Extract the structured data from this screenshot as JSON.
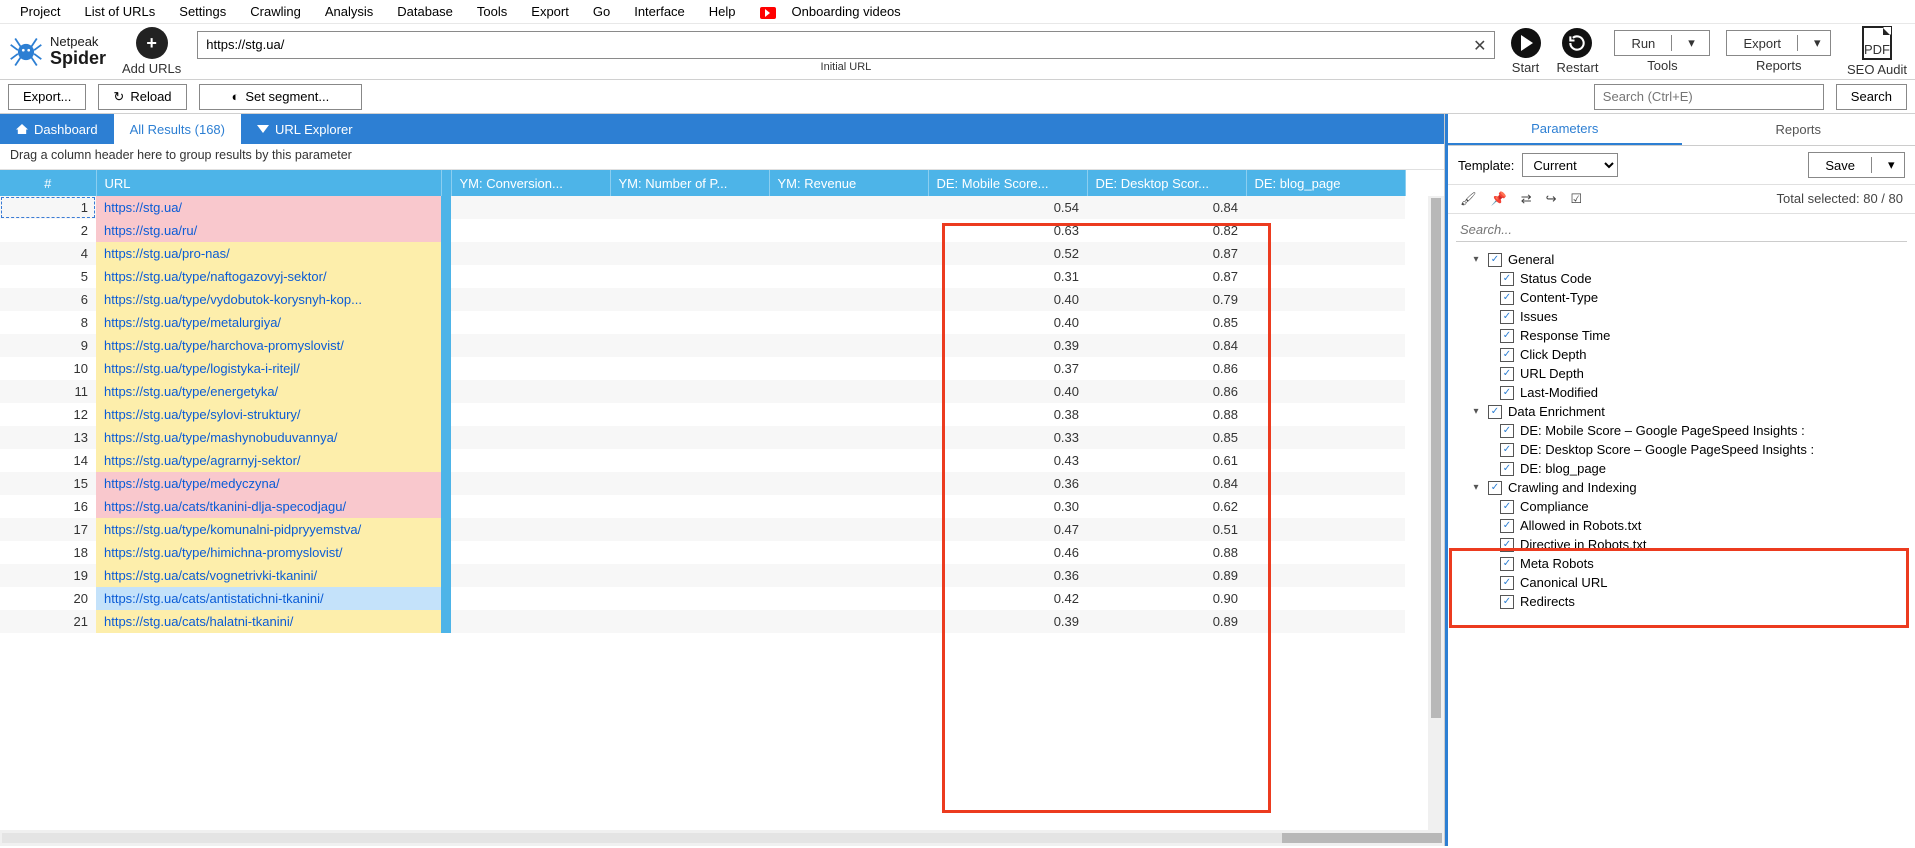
{
  "menu": [
    "Project",
    "List of URLs",
    "Settings",
    "Crawling",
    "Analysis",
    "Database",
    "Tools",
    "Export",
    "Go",
    "Interface",
    "Help"
  ],
  "menu_onboarding": "Onboarding videos",
  "logo": {
    "l1": "Netpeak",
    "l2": "Spider"
  },
  "toolbar": {
    "add_urls": "Add URLs",
    "initial_url": "Initial URL",
    "url_value": "https://stg.ua/",
    "start": "Start",
    "restart": "Restart",
    "run": "Run",
    "tools": "Tools",
    "export": "Export",
    "reports": "Reports",
    "seo_audit": "SEO Audit",
    "pdf": "PDF"
  },
  "toolbar2": {
    "export": "Export...",
    "reload": "Reload",
    "set_segment": "Set segment...",
    "search_ph": "Search (Ctrl+E)",
    "search": "Search"
  },
  "tabs": {
    "dashboard": "Dashboard",
    "all_results": "All Results (168)",
    "url_explorer": "URL Explorer"
  },
  "group_hint": "Drag a column header here to group results by this parameter",
  "columns": {
    "idx": "#",
    "url": "URL",
    "ym1": "YM: Conversion...",
    "ym2": "YM: Number of P...",
    "ym3": "YM: Revenue",
    "de1": "DE: Mobile Score...",
    "de2": "DE: Desktop Scor...",
    "de3": "DE: blog_page"
  },
  "rows": [
    {
      "i": 1,
      "url": "https://stg.ua/",
      "m": "0.54",
      "d": "0.84",
      "c": "pink",
      "sel": true
    },
    {
      "i": 2,
      "url": "https://stg.ua/ru/",
      "m": "0.63",
      "d": "0.82",
      "c": "pink"
    },
    {
      "i": 4,
      "url": "https://stg.ua/pro-nas/",
      "m": "0.52",
      "d": "0.87",
      "c": "yellow"
    },
    {
      "i": 5,
      "url": "https://stg.ua/type/naftogazovyj-sektor/",
      "m": "0.31",
      "d": "0.87",
      "c": "yellow"
    },
    {
      "i": 6,
      "url": "https://stg.ua/type/vydobutok-korysnyh-kop...",
      "m": "0.40",
      "d": "0.79",
      "c": "yellow"
    },
    {
      "i": 8,
      "url": "https://stg.ua/type/metalurgiya/",
      "m": "0.40",
      "d": "0.85",
      "c": "yellow"
    },
    {
      "i": 9,
      "url": "https://stg.ua/type/harchova-promyslovist/",
      "m": "0.39",
      "d": "0.84",
      "c": "yellow"
    },
    {
      "i": 10,
      "url": "https://stg.ua/type/logistyka-i-ritejl/",
      "m": "0.37",
      "d": "0.86",
      "c": "yellow"
    },
    {
      "i": 11,
      "url": "https://stg.ua/type/energetyka/",
      "m": "0.40",
      "d": "0.86",
      "c": "yellow"
    },
    {
      "i": 12,
      "url": "https://stg.ua/type/sylovi-struktury/",
      "m": "0.38",
      "d": "0.88",
      "c": "yellow"
    },
    {
      "i": 13,
      "url": "https://stg.ua/type/mashynobuduvannya/",
      "m": "0.33",
      "d": "0.85",
      "c": "yellow"
    },
    {
      "i": 14,
      "url": "https://stg.ua/type/agrarnyj-sektor/",
      "m": "0.43",
      "d": "0.61",
      "c": "yellow"
    },
    {
      "i": 15,
      "url": "https://stg.ua/type/medyczyna/",
      "m": "0.36",
      "d": "0.84",
      "c": "pink"
    },
    {
      "i": 16,
      "url": "https://stg.ua/cats/tkanini-dlja-specodjagu/",
      "m": "0.30",
      "d": "0.62",
      "c": "pink"
    },
    {
      "i": 17,
      "url": "https://stg.ua/type/komunalni-pidpryyemstva/",
      "m": "0.47",
      "d": "0.51",
      "c": "yellow"
    },
    {
      "i": 18,
      "url": "https://stg.ua/type/himichna-promyslovist/",
      "m": "0.46",
      "d": "0.88",
      "c": "yellow"
    },
    {
      "i": 19,
      "url": "https://stg.ua/cats/vognetrivki-tkanini/",
      "m": "0.36",
      "d": "0.89",
      "c": "yellow"
    },
    {
      "i": 20,
      "url": "https://stg.ua/cats/antistatichni-tkanini/",
      "m": "0.42",
      "d": "0.90",
      "c": "blue"
    },
    {
      "i": 21,
      "url": "https://stg.ua/cats/halatni-tkanini/",
      "m": "0.39",
      "d": "0.89",
      "c": "yellow"
    }
  ],
  "right": {
    "tabs": {
      "parameters": "Parameters",
      "reports": "Reports"
    },
    "template": "Template:",
    "template_val": "Current",
    "save": "Save",
    "total": "Total selected: 80 / 80",
    "search_ph": "Search...",
    "tree": [
      {
        "lvl": 0,
        "arrow": "▾",
        "label": "General"
      },
      {
        "lvl": 1,
        "label": "Status Code"
      },
      {
        "lvl": 1,
        "label": "Content-Type"
      },
      {
        "lvl": 1,
        "label": "Issues"
      },
      {
        "lvl": 1,
        "label": "Response Time"
      },
      {
        "lvl": 1,
        "label": "Click Depth"
      },
      {
        "lvl": 1,
        "label": "URL Depth"
      },
      {
        "lvl": 1,
        "label": "Last-Modified"
      },
      {
        "lvl": 0,
        "arrow": "▾",
        "label": "Data Enrichment"
      },
      {
        "lvl": 1,
        "label": "DE: Mobile Score  –  Google PageSpeed Insights  :"
      },
      {
        "lvl": 1,
        "label": "DE: Desktop Score  –  Google PageSpeed Insights  :"
      },
      {
        "lvl": 1,
        "label": "DE: blog_page"
      },
      {
        "lvl": 0,
        "arrow": "▾",
        "label": "Crawling and Indexing"
      },
      {
        "lvl": 1,
        "label": "Compliance"
      },
      {
        "lvl": 1,
        "label": "Allowed in Robots.txt"
      },
      {
        "lvl": 1,
        "label": "Directive in Robots.txt"
      },
      {
        "lvl": 1,
        "label": "Meta Robots"
      },
      {
        "lvl": 1,
        "label": "Canonical URL"
      },
      {
        "lvl": 1,
        "label": "Redirects"
      }
    ]
  }
}
